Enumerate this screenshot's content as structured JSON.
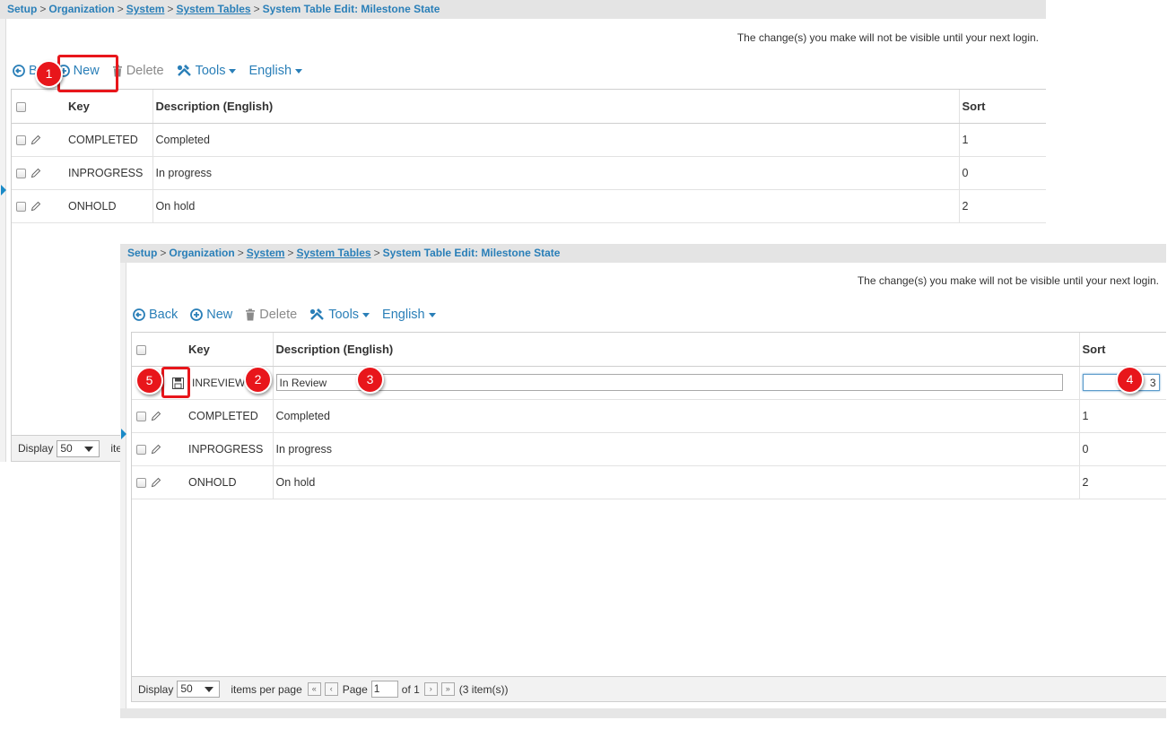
{
  "breadcrumb": {
    "setup": "Setup",
    "organization": "Organization",
    "system": "System",
    "system_tables": "System Tables",
    "current": "System Table Edit: Milestone State",
    "separator": ">"
  },
  "notice": "The change(s) you make will not be visible until your next login.",
  "toolbar": {
    "back": "Back",
    "back_partial": "B",
    "new": "New",
    "delete": "Delete",
    "tools": "Tools",
    "language": "English"
  },
  "columns": {
    "key": "Key",
    "description": "Description (English)",
    "sort": "Sort"
  },
  "rows": [
    {
      "key": "COMPLETED",
      "description": "Completed",
      "sort": "1"
    },
    {
      "key": "INPROGRESS",
      "description": "In progress",
      "sort": "0"
    },
    {
      "key": "ONHOLD",
      "description": "On hold",
      "sort": "2"
    }
  ],
  "new_row": {
    "key": "INREVIEW",
    "description": "In Review",
    "sort": "3"
  },
  "pager": {
    "display_label": "Display",
    "page_size": "50",
    "items_per_page": "items per page",
    "items_partial": "ite",
    "page_label": "Page",
    "page_value": "1",
    "of_label": "of 1",
    "item_count": "(3 item(s))"
  },
  "markers": [
    "1",
    "2",
    "3",
    "4",
    "5"
  ],
  "colors": {
    "link": "#2a7fb8",
    "marker": "#e8161b",
    "breadcrumb_bg": "#e4e4e4"
  }
}
